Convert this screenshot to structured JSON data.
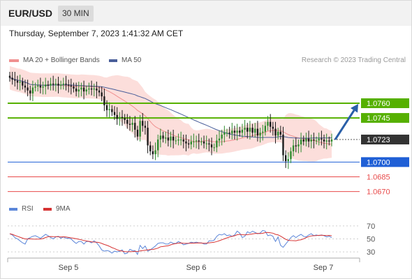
{
  "header": {
    "pair": "EUR/USD",
    "timeframe": "30 MIN",
    "datetime": "Thursday, September 7, 2023 1:41:32 AM CET"
  },
  "legend": {
    "bb_label": "MA 20 + Bollinger Bands",
    "ma50_label": "MA 50",
    "rsi_label": "RSI",
    "rsi_ma_label": "9MA",
    "credit": "Research © 2023 Trading Central"
  },
  "colors": {
    "bull": "#2e8b2e",
    "bear": "#1a1a1a",
    "band_fill": "#fbd6d2",
    "ma20": "#f09090",
    "ma50": "#4a5f9a",
    "resistance": "#56b000",
    "current": "#333333",
    "support": "#1f5fd6",
    "target": "#e84a4a",
    "rsi": "#5b86d9",
    "rsi_ma": "#d63333",
    "arrow": "#2a5fa8"
  },
  "chart_data": {
    "type": "candlestick",
    "price_axis_range": [
      1.0664,
      1.0792
    ],
    "x_ticks": [
      "Sep 5",
      "Sep 6",
      "Sep 7"
    ],
    "levels": [
      {
        "label": "1.0760",
        "value": 1.076,
        "kind": "resistance"
      },
      {
        "label": "1.0745",
        "value": 1.0745,
        "kind": "resistance"
      },
      {
        "label": "1.0723",
        "value": 1.0723,
        "kind": "current"
      },
      {
        "label": "1.0700",
        "value": 1.07,
        "kind": "support"
      },
      {
        "label": "1.0685",
        "value": 1.0685,
        "kind": "target"
      },
      {
        "label": "1.0670",
        "value": 1.067,
        "kind": "target"
      }
    ],
    "closes": [
      1.0786,
      1.0784,
      1.0783,
      1.0781,
      1.0782,
      1.0778,
      1.0776,
      1.0773,
      1.077,
      1.0776,
      1.0777,
      1.0778,
      1.0776,
      1.0777,
      1.0779,
      1.0778,
      1.078,
      1.0779,
      1.078,
      1.0778,
      1.0779,
      1.078,
      1.0779,
      1.0778,
      1.0777,
      1.0775,
      1.0772,
      1.0774,
      1.0776,
      1.0772,
      1.0774,
      1.0775,
      1.0774,
      1.0775,
      1.0773,
      1.0771,
      1.0767,
      1.0758,
      1.0753,
      1.0754,
      1.0751,
      1.0748,
      1.0744,
      1.0746,
      1.0745,
      1.0743,
      1.0739,
      1.0738,
      1.074,
      1.0733,
      1.0726,
      1.0742,
      1.0737,
      1.0735,
      1.0717,
      1.0711,
      1.0708,
      1.0712,
      1.0723,
      1.0727,
      1.0724,
      1.0725,
      1.0722,
      1.0726,
      1.0722,
      1.0722,
      1.0723,
      1.0723,
      1.0721,
      1.0719,
      1.0718,
      1.0721,
      1.0721,
      1.0722,
      1.0721,
      1.0721,
      1.0719,
      1.0719,
      1.0718,
      1.0715,
      1.0715,
      1.0722,
      1.0724,
      1.0728,
      1.073,
      1.073,
      1.0729,
      1.0732,
      1.073,
      1.0732,
      1.073,
      1.0733,
      1.0735,
      1.0731,
      1.0735,
      1.073,
      1.0734,
      1.0727,
      1.073,
      1.0731,
      1.0737,
      1.0741,
      1.0736,
      1.0734,
      1.0727,
      1.0731,
      1.0728,
      1.0707,
      1.0701,
      1.0703,
      1.0711,
      1.0717,
      1.0716,
      1.0718,
      1.0723,
      1.0721,
      1.0724,
      1.0721,
      1.0723,
      1.0722,
      1.0722,
      1.0724,
      1.0723,
      1.0721,
      1.0722,
      1.0721,
      1.0723
    ],
    "forecast_arrow": {
      "from": 1.0723,
      "to": 1.076
    },
    "rsi": {
      "levels": [
        30,
        50,
        70
      ],
      "values": [
        58,
        56,
        52,
        50,
        47,
        44,
        42,
        50,
        52,
        54,
        55,
        53,
        51,
        54,
        57,
        55,
        52,
        50,
        53,
        54,
        51,
        53,
        51,
        51,
        50,
        46,
        43,
        46,
        46,
        42,
        46,
        46,
        44,
        47,
        44,
        39,
        33,
        31,
        32,
        31,
        28,
        31,
        30,
        31,
        33,
        27,
        28,
        34,
        32,
        32,
        26,
        40,
        35,
        39,
        31,
        33,
        36,
        39,
        43,
        44,
        44,
        42,
        42,
        45,
        43,
        43,
        46,
        44,
        41,
        42,
        43,
        45,
        44,
        45,
        44,
        44,
        42,
        42,
        47,
        47,
        48,
        54,
        57,
        56,
        58,
        55,
        56,
        54,
        56,
        62,
        59,
        52,
        54,
        61,
        59,
        62,
        60,
        58,
        59,
        63,
        62,
        55,
        56,
        54,
        46,
        53,
        40,
        37,
        42,
        47,
        52,
        55,
        52,
        55,
        57,
        54,
        53,
        56,
        58,
        55,
        56,
        55,
        56,
        55,
        53,
        54,
        52
      ]
    }
  }
}
